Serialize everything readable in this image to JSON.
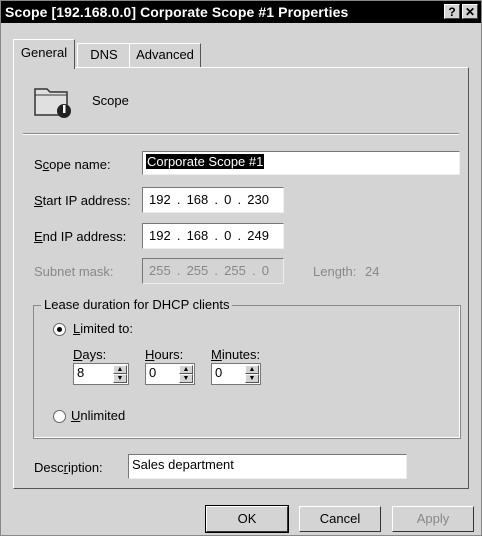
{
  "window": {
    "title": "Scope [192.168.0.0] Corporate Scope #1 Properties",
    "help_label": "?",
    "close_label": "✕"
  },
  "tabs": [
    {
      "label": "General",
      "active": true
    },
    {
      "label": "DNS",
      "active": false
    },
    {
      "label": "Advanced",
      "active": false
    }
  ],
  "header": {
    "icon": "scope-folder-icon",
    "label": "Scope"
  },
  "scope_name": {
    "label_pre": "S",
    "label_u": "c",
    "label_post": "ope name:",
    "value": "Corporate Scope #1"
  },
  "start_ip": {
    "label_pre": "",
    "label_u": "S",
    "label_post": "tart IP address:",
    "octets": [
      "192",
      "168",
      "0",
      "230"
    ]
  },
  "end_ip": {
    "label_pre": "",
    "label_u": "E",
    "label_post": "nd IP address:",
    "octets": [
      "192",
      "168",
      "0",
      "249"
    ]
  },
  "subnet_mask": {
    "label": "Subnet mask:",
    "octets": [
      "255",
      "255",
      "255",
      "0"
    ],
    "length_label": "Length:",
    "length_value": "24"
  },
  "lease": {
    "group_label": "Lease duration for DHCP clients",
    "limited": {
      "label_u": "L",
      "label_post": "imited to:",
      "selected": true
    },
    "days": {
      "label_u": "D",
      "label_post": "ays:",
      "value": "8"
    },
    "hours": {
      "label_u": "H",
      "label_post": "ours:",
      "value": "0"
    },
    "minutes": {
      "label_u": "M",
      "label_post": "inutes:",
      "value": "0"
    },
    "unlimited": {
      "label_u": "U",
      "label_post": "nlimited",
      "selected": false
    }
  },
  "description": {
    "label_pre": "Desc",
    "label_u": "r",
    "label_post": "iption:",
    "value": "Sales department"
  },
  "buttons": {
    "ok": "OK",
    "cancel": "Cancel",
    "apply": "Apply"
  }
}
